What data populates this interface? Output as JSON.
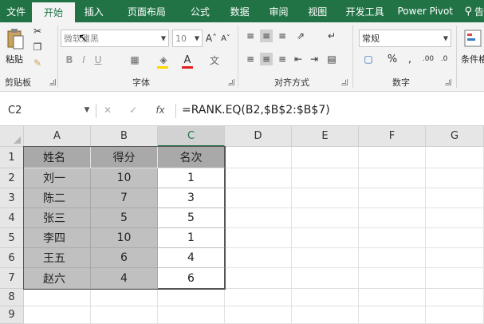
{
  "ribbon_tabs": [
    {
      "label": "文件",
      "active": false
    },
    {
      "label": "开始",
      "active": true
    },
    {
      "label": "插入",
      "active": false
    },
    {
      "label": "页面布局",
      "active": false
    },
    {
      "label": "公式",
      "active": false
    },
    {
      "label": "数据",
      "active": false
    },
    {
      "label": "审阅",
      "active": false
    },
    {
      "label": "视图",
      "active": false
    },
    {
      "label": "开发工具",
      "active": false
    },
    {
      "label": "Power Pivot",
      "active": false
    }
  ],
  "tell_me": "告",
  "clipboard": {
    "paste_label": "粘贴",
    "group_label": "剪贴板"
  },
  "font": {
    "name": "微软雅黑",
    "size": "10",
    "group_label": "字体"
  },
  "alignment": {
    "group_label": "对齐方式"
  },
  "number": {
    "format": "常规",
    "group_label": "数字"
  },
  "styles": {
    "cond_format_label": "条件格"
  },
  "formula_bar": {
    "name_box": "C2",
    "fx": "fx",
    "formula": "=RANK.EQ(B2,$B$2:$B$7)"
  },
  "columns": [
    "A",
    "B",
    "C",
    "D",
    "E",
    "F",
    "G"
  ],
  "selected_column": "C",
  "rows": [
    "1",
    "2",
    "3",
    "4",
    "5",
    "6",
    "7",
    "8",
    "9"
  ],
  "table": {
    "headers": [
      "姓名",
      "得分",
      "名次"
    ],
    "data": [
      [
        "刘一",
        "10",
        "1"
      ],
      [
        "陈二",
        "7",
        "3"
      ],
      [
        "张三",
        "5",
        "5"
      ],
      [
        "李四",
        "10",
        "1"
      ],
      [
        "王五",
        "6",
        "4"
      ],
      [
        "赵六",
        "4",
        "6"
      ]
    ]
  },
  "colors": {
    "ribbon_green": "#217346",
    "shade": "#c0c0c0",
    "header_shade": "#a9a9a9"
  }
}
